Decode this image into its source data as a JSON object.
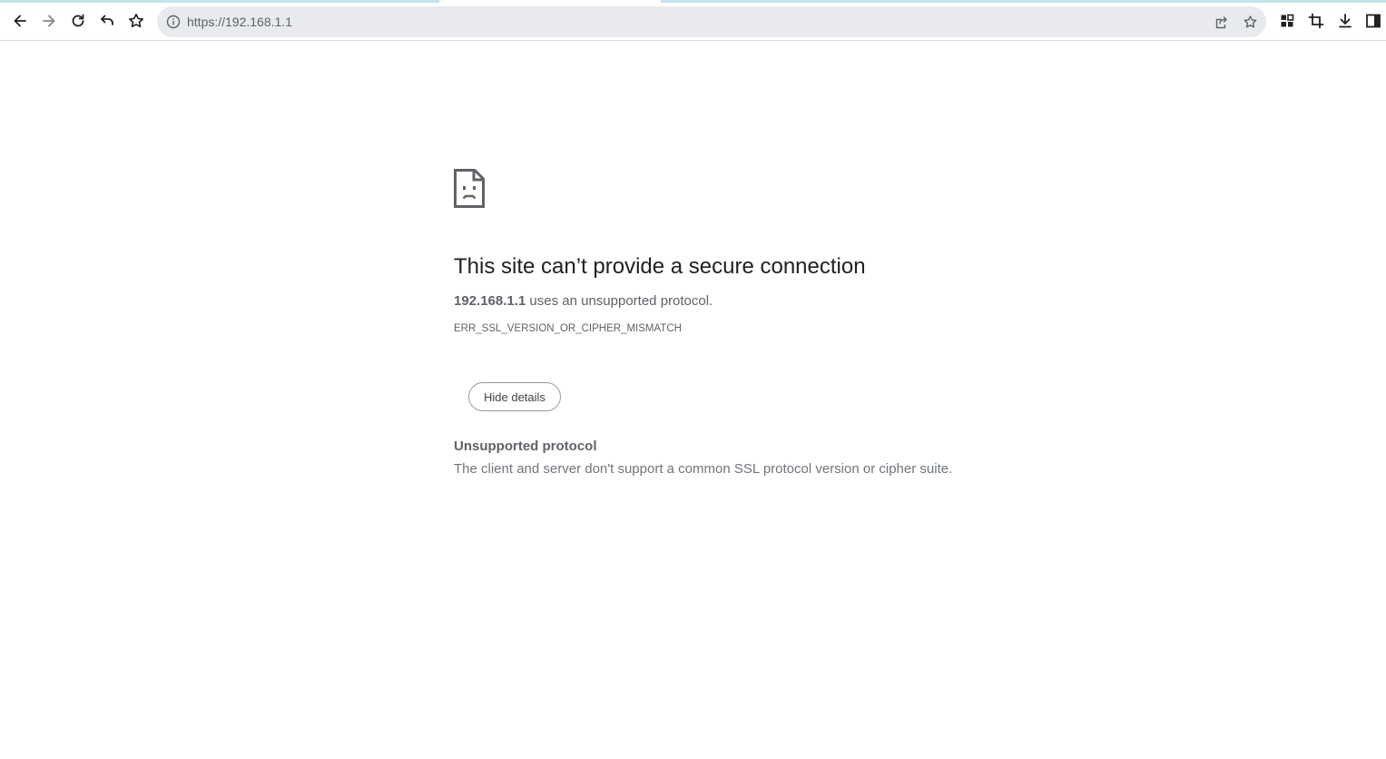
{
  "browser": {
    "url": "https://192.168.1.1",
    "icons": {
      "back": "arrow-left-icon",
      "forward": "arrow-right-icon",
      "reload": "reload-icon",
      "undo": "undo-icon",
      "bookmark": "star-icon",
      "site_info": "info-icon",
      "share": "share-icon",
      "bookmark_page": "star-icon",
      "extensions": "extensions-icon",
      "crop": "crop-icon",
      "downloads": "download-icon",
      "side_panel": "side-panel-icon"
    }
  },
  "error_page": {
    "title": "This site can’t provide a secure connection",
    "host": "192.168.1.1",
    "message": " uses an unsupported protocol.",
    "error_code": "ERR_SSL_VERSION_OR_CIPHER_MISMATCH",
    "details_button": "Hide details",
    "details_heading": "Unsupported protocol",
    "details_text": "The client and server don't support a common SSL protocol version or cipher suite."
  }
}
